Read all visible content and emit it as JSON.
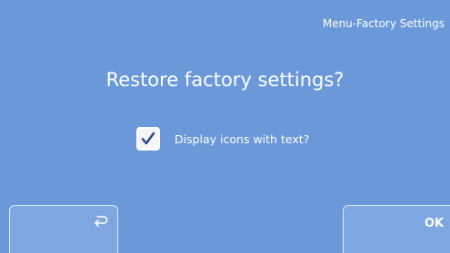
{
  "header": {
    "title": "Menu-Factory Settings"
  },
  "dialog": {
    "question": "Restore factory settings?",
    "option": {
      "label": "Display icons with text?",
      "checked": true
    }
  },
  "buttons": {
    "back_icon": "back-return-icon",
    "ok_label": "OK"
  },
  "colors": {
    "background": "#6a98d8",
    "button_fill": "#7ea6e0",
    "text": "#ffffff"
  }
}
